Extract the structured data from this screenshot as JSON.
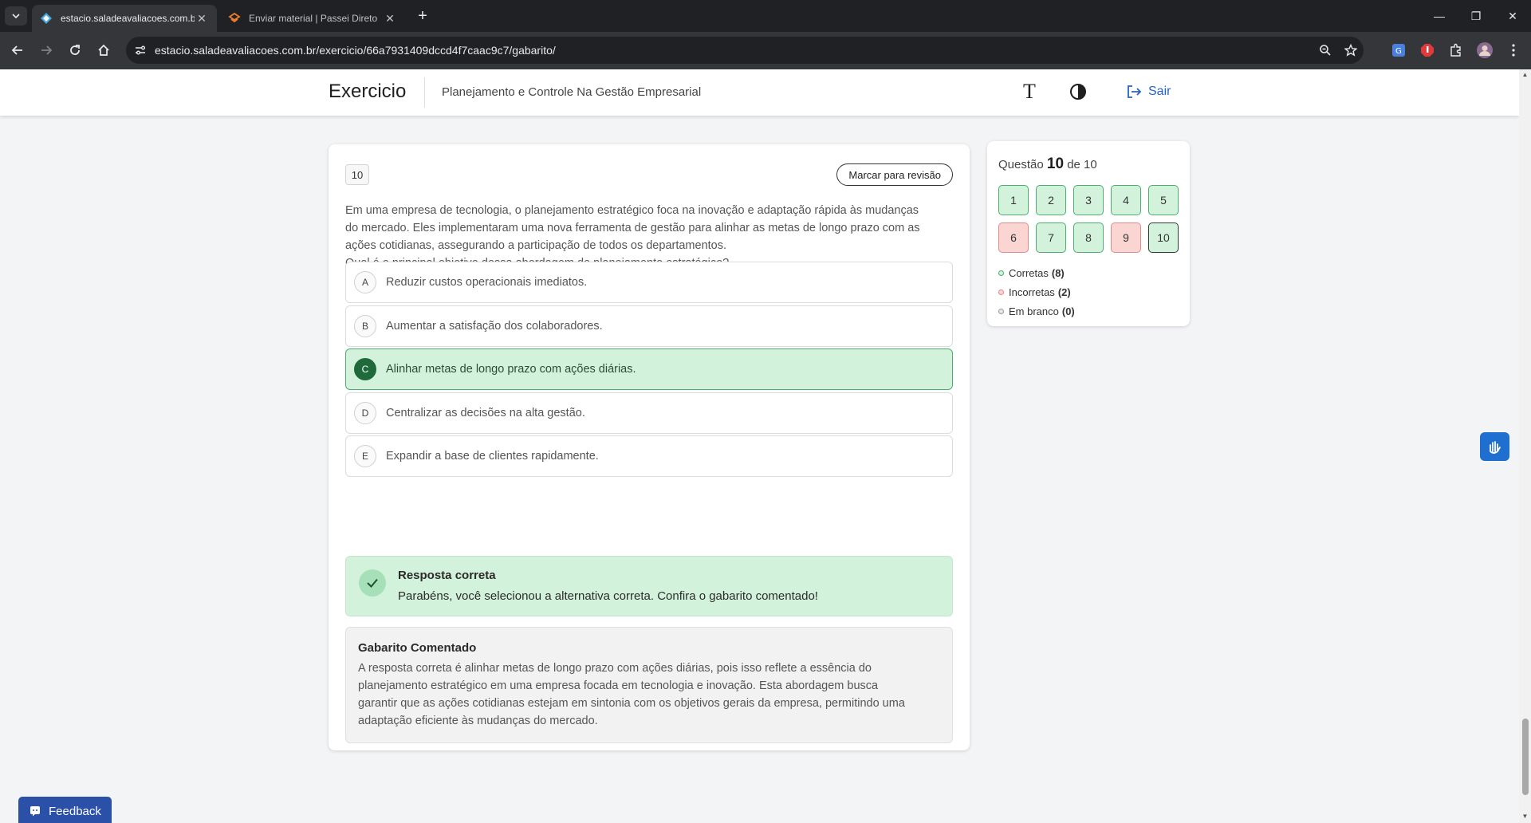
{
  "browser": {
    "tabs": [
      {
        "title": "estacio.saladeavaliacoes.com.br",
        "active": true,
        "icon": "estacio-favicon"
      },
      {
        "title": "Enviar material | Passei Direto",
        "active": false,
        "icon": "passei-direto-favicon"
      }
    ],
    "url": "estacio.saladeavaliacoes.com.br/exercicio/66a7931409dccd4f7caac9c7/gabarito/"
  },
  "header": {
    "title": "Exercicio",
    "course": "Planejamento e Controle Na Gestão Empresarial",
    "font_size_glyph": "T",
    "logout_label": "Sair"
  },
  "question": {
    "number": "10",
    "review_label": "Marcar para revisão",
    "text_lines": [
      "Em uma empresa de tecnologia, o planejamento estratégico foca na inovação e adaptação rápida às mudanças",
      "do mercado. Eles implementaram uma nova ferramenta de gestão para alinhar as metas de longo prazo com as",
      "ações cotidianas, assegurando a participação de todos os departamentos.",
      "Qual é o principal objetivo dessa abordagem de planejamento estratégico?"
    ],
    "options": [
      {
        "letter": "A",
        "text": "Reduzir custos operacionais imediatos.",
        "selected": false
      },
      {
        "letter": "B",
        "text": "Aumentar a satisfação dos colaboradores.",
        "selected": false
      },
      {
        "letter": "C",
        "text": "Alinhar metas de longo prazo com ações diárias.",
        "selected": true
      },
      {
        "letter": "D",
        "text": "Centralizar as decisões na alta gestão.",
        "selected": false
      },
      {
        "letter": "E",
        "text": "Expandir a base de clientes rapidamente.",
        "selected": false
      }
    ],
    "feedback": {
      "title": "Resposta correta",
      "message": "Parabéns, você selecionou a alternativa correta. Confira o gabarito comentado!"
    },
    "comment": {
      "title": "Gabarito Comentado",
      "lines": [
        "A resposta correta é alinhar metas de longo prazo com ações diárias, pois isso reflete a essência do",
        "planejamento estratégico em uma empresa focada em tecnologia e inovação. Esta abordagem busca",
        "garantir que as ações cotidianas estejam em sintonia com os objetivos gerais da empresa, permitindo uma",
        "adaptação eficiente às mudanças do mercado."
      ]
    }
  },
  "navigator": {
    "label_prefix": "Questão",
    "current": "10",
    "label_of": "de 10",
    "questions": [
      {
        "n": "1",
        "status": "correct"
      },
      {
        "n": "2",
        "status": "correct"
      },
      {
        "n": "3",
        "status": "correct"
      },
      {
        "n": "4",
        "status": "correct"
      },
      {
        "n": "5",
        "status": "correct"
      },
      {
        "n": "6",
        "status": "wrong"
      },
      {
        "n": "7",
        "status": "correct"
      },
      {
        "n": "8",
        "status": "correct"
      },
      {
        "n": "9",
        "status": "wrong"
      },
      {
        "n": "10",
        "status": "correct"
      }
    ],
    "legend": [
      {
        "label": "Corretas",
        "count": "(8)",
        "color": "#4aaf6b"
      },
      {
        "label": "Incorretas",
        "count": "(2)",
        "color": "#e08a8a"
      },
      {
        "label": "Em branco",
        "count": "(0)",
        "color": "#9a9a9a"
      }
    ]
  },
  "feedback_tab": {
    "label": "Feedback"
  },
  "colors": {
    "accent": "#2563c9",
    "correct": "#d3f2dc",
    "wrong": "#fbd5d1",
    "selected_letter": "#1f6a3a"
  }
}
